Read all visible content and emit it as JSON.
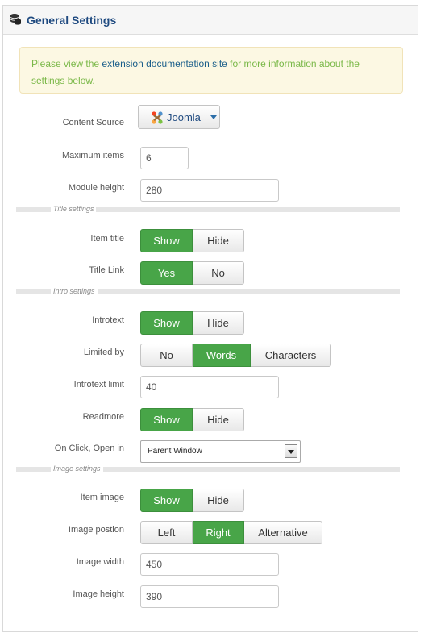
{
  "header": {
    "title": "General Settings",
    "icon": "database-stack-icon"
  },
  "info": {
    "prefix": "Please view the ",
    "link": "extension documentation site",
    "suffix": " for more information about the settings below."
  },
  "content_source": {
    "label": "Content Source",
    "value": "Joomla",
    "icon": "joomla-icon"
  },
  "maximum_items": {
    "label": "Maximum items",
    "value": "6"
  },
  "module_height": {
    "label": "Module height",
    "value": "280"
  },
  "sections": {
    "title": "Title settings",
    "intro": "Intro settings",
    "image": "Image settings"
  },
  "item_title": {
    "label": "Item title",
    "options": [
      "Show",
      "Hide"
    ],
    "selected": "Show"
  },
  "title_link": {
    "label": "Title Link",
    "options": [
      "Yes",
      "No"
    ],
    "selected": "Yes"
  },
  "introtext": {
    "label": "Introtext",
    "options": [
      "Show",
      "Hide"
    ],
    "selected": "Show"
  },
  "limited_by": {
    "label": "Limited by",
    "options": [
      "No",
      "Words",
      "Characters"
    ],
    "selected": "Words"
  },
  "introtext_limit": {
    "label": "Introtext limit",
    "value": "40"
  },
  "readmore": {
    "label": "Readmore",
    "options": [
      "Show",
      "Hide"
    ],
    "selected": "Show"
  },
  "on_click": {
    "label": "On Click, Open in",
    "value": "Parent Window"
  },
  "item_image": {
    "label": "Item image",
    "options": [
      "Show",
      "Hide"
    ],
    "selected": "Show"
  },
  "image_position": {
    "label": "Image postion",
    "options": [
      "Left",
      "Right",
      "Alternative"
    ],
    "selected": "Right"
  },
  "image_width": {
    "label": "Image width",
    "value": "450"
  },
  "image_height": {
    "label": "Image height",
    "value": "390"
  },
  "colors": {
    "active": "#48a548",
    "title": "#1f4a80",
    "info_bg": "#fcf8e3",
    "info_text": "#7ab848"
  }
}
